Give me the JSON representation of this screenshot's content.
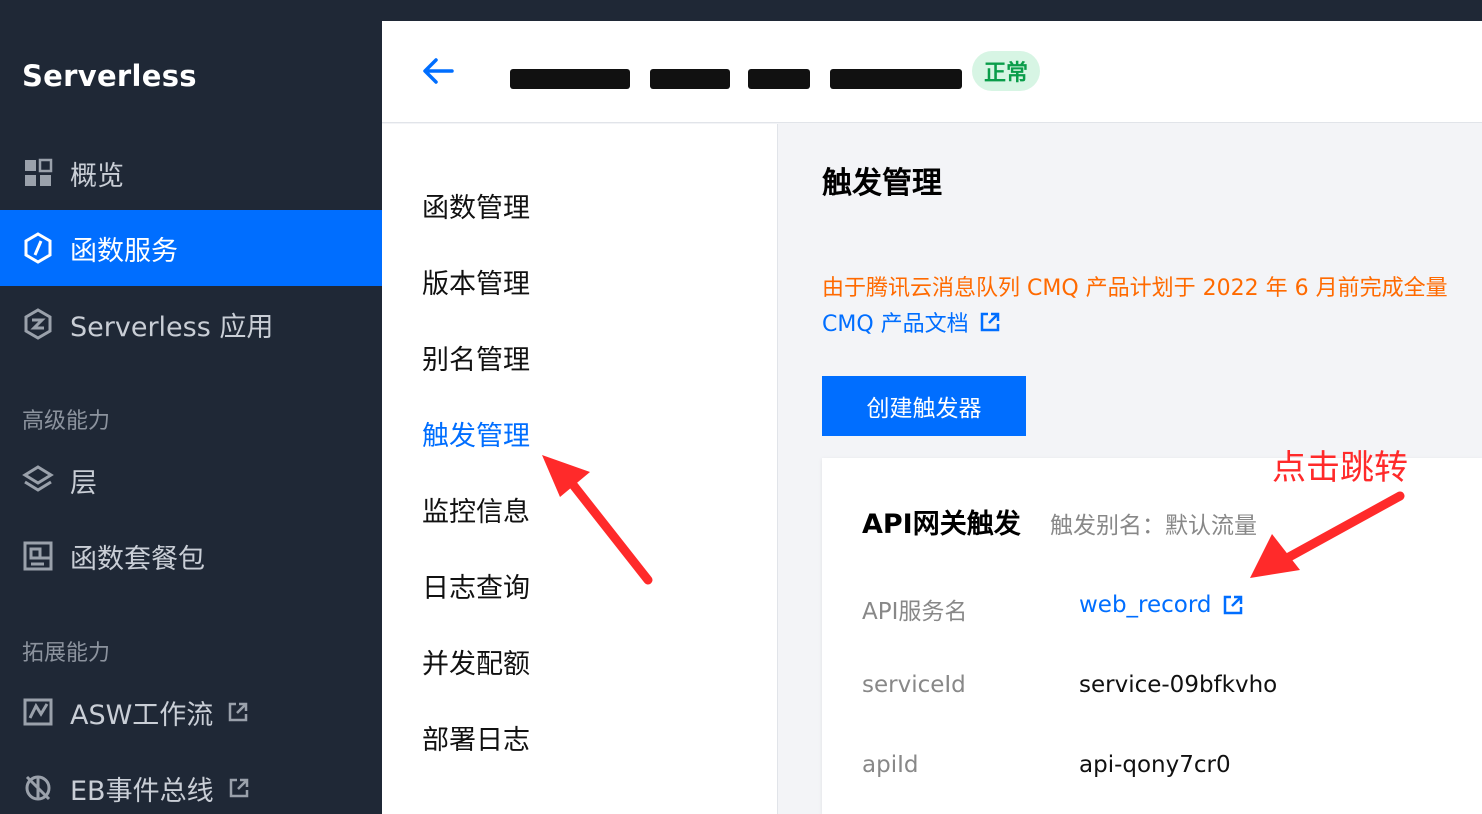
{
  "sidebar": {
    "brand": "Serverless",
    "items": [
      {
        "label": "概览",
        "icon": "grid-icon"
      },
      {
        "label": "函数服务",
        "icon": "function-icon"
      },
      {
        "label": "Serverless 应用",
        "icon": "app-icon"
      }
    ],
    "section_advanced": "高级能力",
    "advanced_items": [
      {
        "label": "层",
        "icon": "layers-icon"
      },
      {
        "label": "函数套餐包",
        "icon": "package-icon"
      }
    ],
    "section_extension": "拓展能力",
    "extension_items": [
      {
        "label": "ASW工作流",
        "icon": "workflow-icon"
      },
      {
        "label": "EB事件总线",
        "icon": "eventbus-icon"
      }
    ]
  },
  "header": {
    "status": "正常"
  },
  "subnav": {
    "items": [
      "函数管理",
      "版本管理",
      "别名管理",
      "触发管理",
      "监控信息",
      "日志查询",
      "并发配额",
      "部署日志"
    ],
    "active_index": 3
  },
  "main": {
    "title": "触发管理",
    "notice": "由于腾讯云消息队列 CMQ 产品计划于 2022 年 6 月前完成全量",
    "doc_link": "CMQ 产品文档",
    "create_button": "创建触发器",
    "card": {
      "title": "API网关触发",
      "alias": "触发别名：默认流量",
      "rows": [
        {
          "label": "API服务名",
          "value": "web_record"
        },
        {
          "label": "serviceId",
          "value": "service-09bfkvho"
        },
        {
          "label": "apiId",
          "value": "api-qony7cr0"
        }
      ]
    }
  },
  "annotation": {
    "text": "点击跳转"
  },
  "colors": {
    "sidebar_bg": "#1f2836",
    "accent": "#006eff",
    "notice": "#ff6a00",
    "annotation": "#ff2a2a",
    "status_bg": "#d7f5e4",
    "status_text": "#0a9d4a"
  }
}
